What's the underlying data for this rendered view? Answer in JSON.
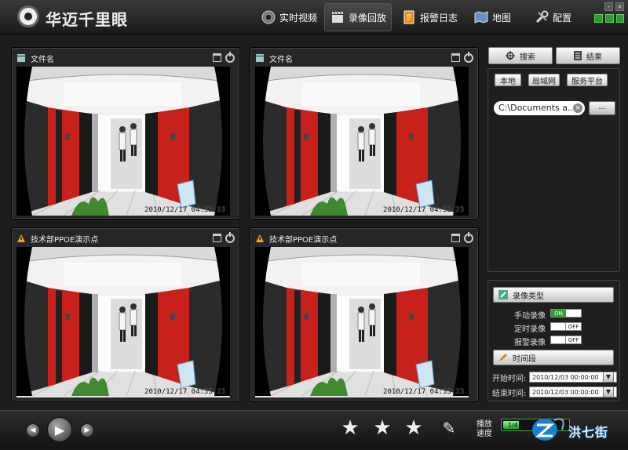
{
  "app": {
    "title": "华迈千里眼"
  },
  "nav": [
    {
      "label": "实时视频",
      "icon": "camera-icon"
    },
    {
      "label": "录像回放",
      "icon": "film-clapper-icon"
    },
    {
      "label": "报警日志",
      "icon": "alarm-log-icon"
    },
    {
      "label": "地图",
      "icon": "map-icon"
    },
    {
      "label": "配置",
      "icon": "wrench-config-icon"
    }
  ],
  "window_controls": {
    "minimize": "–",
    "close": "×"
  },
  "panels": [
    {
      "title": "文件名",
      "timestamp": "2010/12/17 04:33:23",
      "icon": "film-clapper-icon"
    },
    {
      "title": "文件名",
      "timestamp": "2010/12/17 04:33:23",
      "icon": "film-clapper-icon"
    },
    {
      "title": "技术部PPOE演示点",
      "timestamp": "2010/12/17 04:33:23",
      "icon": "warning-icon"
    },
    {
      "title": "技术部PPOE演示点",
      "timestamp": "2010/12/17 04:33:23",
      "icon": "warning-icon"
    }
  ],
  "sidebar": {
    "search_label": "搜索",
    "results_label": "结果",
    "tabs": [
      "本地",
      "局域网",
      "服务平台"
    ],
    "path_value": "C:\\Documents a...",
    "browse_label": "...",
    "record_type_title": "录像类型",
    "record_types": [
      {
        "label": "手动录像",
        "state": "ON"
      },
      {
        "label": "定时录像",
        "state": "OFF"
      },
      {
        "label": "报警录像",
        "state": "OFF"
      }
    ],
    "time_title": "时间段",
    "start_label": "开始时间:",
    "start_value": "2010/12/03 00:00:00",
    "end_label": "结束时间:",
    "end_value": "2010/12/03 00:00:00"
  },
  "bottom": {
    "speed_label": "播放速度",
    "speed_value": "1/4",
    "watermark": "洪七街"
  },
  "colors": {
    "accent_green": "#2fa02f",
    "rack_red": "#c8201a"
  }
}
